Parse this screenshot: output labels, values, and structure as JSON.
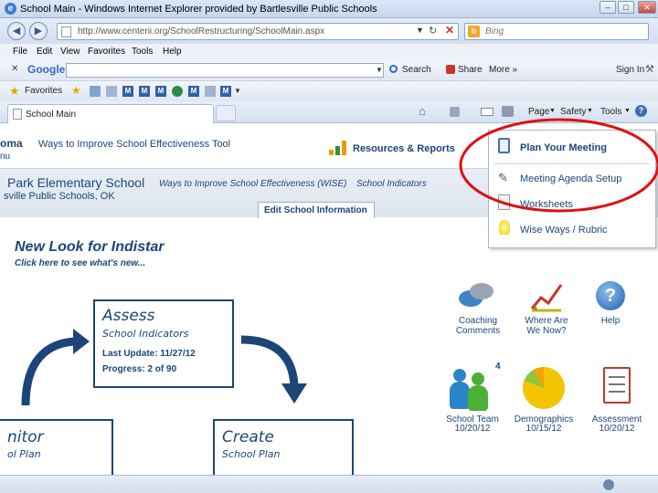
{
  "window": {
    "title": "School Main - Windows Internet Explorer provided by Bartlesville Public Schools"
  },
  "address": {
    "url": "http://www.centerii.org/SchoolRestructuring/SchoolMain.aspx",
    "search_placeholder": "Bing"
  },
  "menu": {
    "items": [
      "File",
      "Edit",
      "View",
      "Favorites",
      "Tools",
      "Help"
    ]
  },
  "google_bar": {
    "logo": "Google",
    "search": "Search",
    "share": "Share",
    "more": "More »",
    "sign_in": "Sign In"
  },
  "favorites_bar": {
    "label": "Favorites"
  },
  "tab": {
    "label": "School Main"
  },
  "command_bar": {
    "page": "Page",
    "safety": "Safety",
    "tools": "Tools"
  },
  "header": {
    "org_partial": "oma",
    "org_partial2": "nu",
    "tool_name": "Ways to Improve School Effectiveness Tool",
    "resources": "Resources & Reports",
    "school_name": "Park Elementary School",
    "wise_link": "Ways to Improve School Effectiveness (WISE)",
    "indicators_link": "School Indicators",
    "district": "sville Public Schools, OK",
    "edit_btn": "Edit School Information"
  },
  "dropdown": {
    "plan": "Plan Your Meeting",
    "items": [
      "Meeting Agenda Setup",
      "Worksheets",
      "Wise Ways / Rubric"
    ]
  },
  "main": {
    "new_look": "New Look for Indistar",
    "click_here": "Click here to see what's new...",
    "assess": {
      "title": "Assess",
      "subtitle": "School Indicators",
      "last_update": "Last Update: 11/27/12",
      "progress": "Progress: 2 of 90"
    },
    "monitor": {
      "title": "nitor",
      "subtitle": "ol Plan"
    },
    "create": {
      "title": "Create",
      "subtitle": "School Plan"
    }
  },
  "icons": [
    {
      "label1": "Coaching",
      "label2": "Comments"
    },
    {
      "label1": "Where Are",
      "label2": "We Now?"
    },
    {
      "label1": "Help",
      "label2": ""
    },
    {
      "label1": "School Team",
      "label2": "10/20/12",
      "badge": "4"
    },
    {
      "label1": "Demographics",
      "label2": "10/15/12"
    },
    {
      "label1": "Assessment",
      "label2": "10/20/12"
    }
  ]
}
